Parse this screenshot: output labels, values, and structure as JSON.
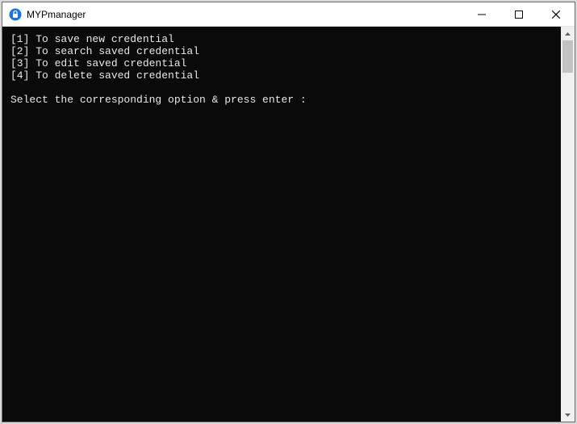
{
  "window": {
    "title": "MYPmanager"
  },
  "console": {
    "lines": [
      "[1] To save new credential",
      "[2] To search saved credential",
      "[3] To edit saved credential",
      "[4] To delete saved credential",
      "",
      "Select the corresponding option & press enter :"
    ]
  }
}
